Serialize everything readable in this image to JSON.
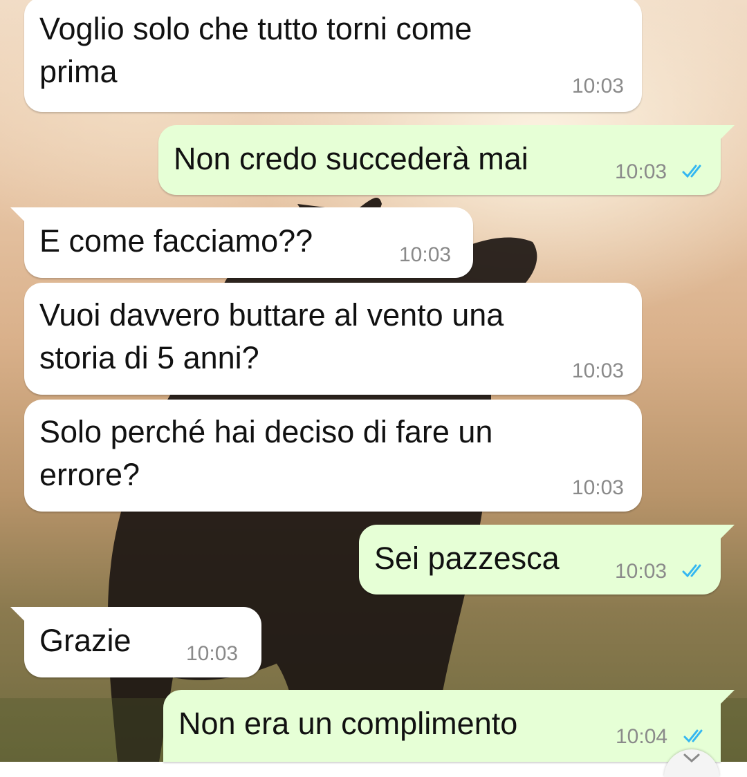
{
  "messages": [
    {
      "direction": "incoming",
      "text": "Voglio solo che tutto torni come\nprima",
      "time": "10:03"
    },
    {
      "direction": "outgoing",
      "text": "Non credo succederà mai",
      "time": "10:03",
      "status": "read"
    },
    {
      "direction": "incoming",
      "text": "E come facciamo??",
      "time": "10:03"
    },
    {
      "direction": "incoming",
      "text": "Vuoi davvero buttare al vento una\nstoria di 5 anni?",
      "time": "10:03"
    },
    {
      "direction": "incoming",
      "text": "Solo perché hai deciso di fare un\nerrore?",
      "time": "10:03"
    },
    {
      "direction": "outgoing",
      "text": "Sei pazzesca",
      "time": "10:03",
      "status": "read"
    },
    {
      "direction": "incoming",
      "text": "Grazie",
      "time": "10:03"
    },
    {
      "direction": "outgoing",
      "text": "Non era un complimento",
      "time": "10:04",
      "status": "read"
    }
  ],
  "colors": {
    "incoming_bubble": "#ffffff",
    "outgoing_bubble": "#e6ffd6",
    "read_ticks": "#34b7f1",
    "timestamp": "#8a8a8a"
  },
  "icons": {
    "read_receipt": "double-check-icon",
    "scroll_down": "chevron-down-icon"
  }
}
